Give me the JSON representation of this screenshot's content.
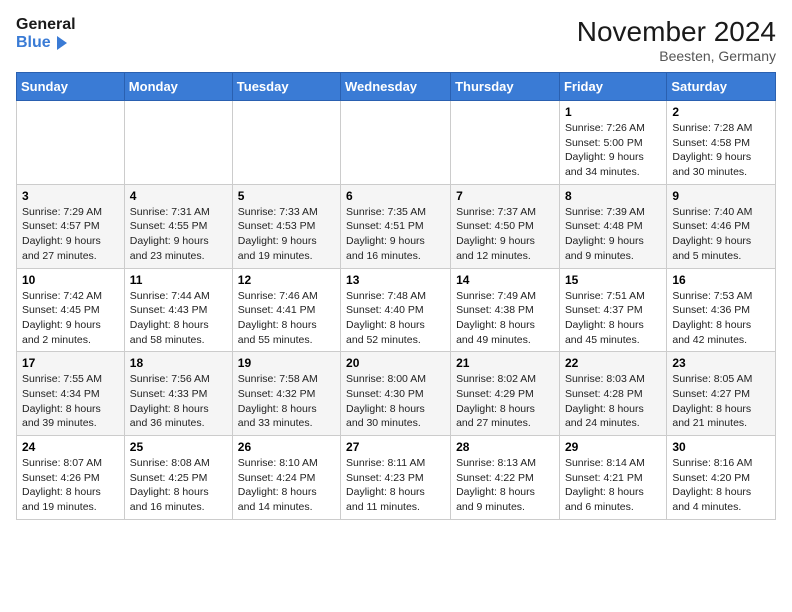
{
  "header": {
    "logo_line1": "General",
    "logo_line2": "Blue",
    "month": "November 2024",
    "location": "Beesten, Germany"
  },
  "weekdays": [
    "Sunday",
    "Monday",
    "Tuesday",
    "Wednesday",
    "Thursday",
    "Friday",
    "Saturday"
  ],
  "weeks": [
    [
      {
        "day": "",
        "info": ""
      },
      {
        "day": "",
        "info": ""
      },
      {
        "day": "",
        "info": ""
      },
      {
        "day": "",
        "info": ""
      },
      {
        "day": "",
        "info": ""
      },
      {
        "day": "1",
        "info": "Sunrise: 7:26 AM\nSunset: 5:00 PM\nDaylight: 9 hours and 34 minutes."
      },
      {
        "day": "2",
        "info": "Sunrise: 7:28 AM\nSunset: 4:58 PM\nDaylight: 9 hours and 30 minutes."
      }
    ],
    [
      {
        "day": "3",
        "info": "Sunrise: 7:29 AM\nSunset: 4:57 PM\nDaylight: 9 hours and 27 minutes."
      },
      {
        "day": "4",
        "info": "Sunrise: 7:31 AM\nSunset: 4:55 PM\nDaylight: 9 hours and 23 minutes."
      },
      {
        "day": "5",
        "info": "Sunrise: 7:33 AM\nSunset: 4:53 PM\nDaylight: 9 hours and 19 minutes."
      },
      {
        "day": "6",
        "info": "Sunrise: 7:35 AM\nSunset: 4:51 PM\nDaylight: 9 hours and 16 minutes."
      },
      {
        "day": "7",
        "info": "Sunrise: 7:37 AM\nSunset: 4:50 PM\nDaylight: 9 hours and 12 minutes."
      },
      {
        "day": "8",
        "info": "Sunrise: 7:39 AM\nSunset: 4:48 PM\nDaylight: 9 hours and 9 minutes."
      },
      {
        "day": "9",
        "info": "Sunrise: 7:40 AM\nSunset: 4:46 PM\nDaylight: 9 hours and 5 minutes."
      }
    ],
    [
      {
        "day": "10",
        "info": "Sunrise: 7:42 AM\nSunset: 4:45 PM\nDaylight: 9 hours and 2 minutes."
      },
      {
        "day": "11",
        "info": "Sunrise: 7:44 AM\nSunset: 4:43 PM\nDaylight: 8 hours and 58 minutes."
      },
      {
        "day": "12",
        "info": "Sunrise: 7:46 AM\nSunset: 4:41 PM\nDaylight: 8 hours and 55 minutes."
      },
      {
        "day": "13",
        "info": "Sunrise: 7:48 AM\nSunset: 4:40 PM\nDaylight: 8 hours and 52 minutes."
      },
      {
        "day": "14",
        "info": "Sunrise: 7:49 AM\nSunset: 4:38 PM\nDaylight: 8 hours and 49 minutes."
      },
      {
        "day": "15",
        "info": "Sunrise: 7:51 AM\nSunset: 4:37 PM\nDaylight: 8 hours and 45 minutes."
      },
      {
        "day": "16",
        "info": "Sunrise: 7:53 AM\nSunset: 4:36 PM\nDaylight: 8 hours and 42 minutes."
      }
    ],
    [
      {
        "day": "17",
        "info": "Sunrise: 7:55 AM\nSunset: 4:34 PM\nDaylight: 8 hours and 39 minutes."
      },
      {
        "day": "18",
        "info": "Sunrise: 7:56 AM\nSunset: 4:33 PM\nDaylight: 8 hours and 36 minutes."
      },
      {
        "day": "19",
        "info": "Sunrise: 7:58 AM\nSunset: 4:32 PM\nDaylight: 8 hours and 33 minutes."
      },
      {
        "day": "20",
        "info": "Sunrise: 8:00 AM\nSunset: 4:30 PM\nDaylight: 8 hours and 30 minutes."
      },
      {
        "day": "21",
        "info": "Sunrise: 8:02 AM\nSunset: 4:29 PM\nDaylight: 8 hours and 27 minutes."
      },
      {
        "day": "22",
        "info": "Sunrise: 8:03 AM\nSunset: 4:28 PM\nDaylight: 8 hours and 24 minutes."
      },
      {
        "day": "23",
        "info": "Sunrise: 8:05 AM\nSunset: 4:27 PM\nDaylight: 8 hours and 21 minutes."
      }
    ],
    [
      {
        "day": "24",
        "info": "Sunrise: 8:07 AM\nSunset: 4:26 PM\nDaylight: 8 hours and 19 minutes."
      },
      {
        "day": "25",
        "info": "Sunrise: 8:08 AM\nSunset: 4:25 PM\nDaylight: 8 hours and 16 minutes."
      },
      {
        "day": "26",
        "info": "Sunrise: 8:10 AM\nSunset: 4:24 PM\nDaylight: 8 hours and 14 minutes."
      },
      {
        "day": "27",
        "info": "Sunrise: 8:11 AM\nSunset: 4:23 PM\nDaylight: 8 hours and 11 minutes."
      },
      {
        "day": "28",
        "info": "Sunrise: 8:13 AM\nSunset: 4:22 PM\nDaylight: 8 hours and 9 minutes."
      },
      {
        "day": "29",
        "info": "Sunrise: 8:14 AM\nSunset: 4:21 PM\nDaylight: 8 hours and 6 minutes."
      },
      {
        "day": "30",
        "info": "Sunrise: 8:16 AM\nSunset: 4:20 PM\nDaylight: 8 hours and 4 minutes."
      }
    ]
  ]
}
